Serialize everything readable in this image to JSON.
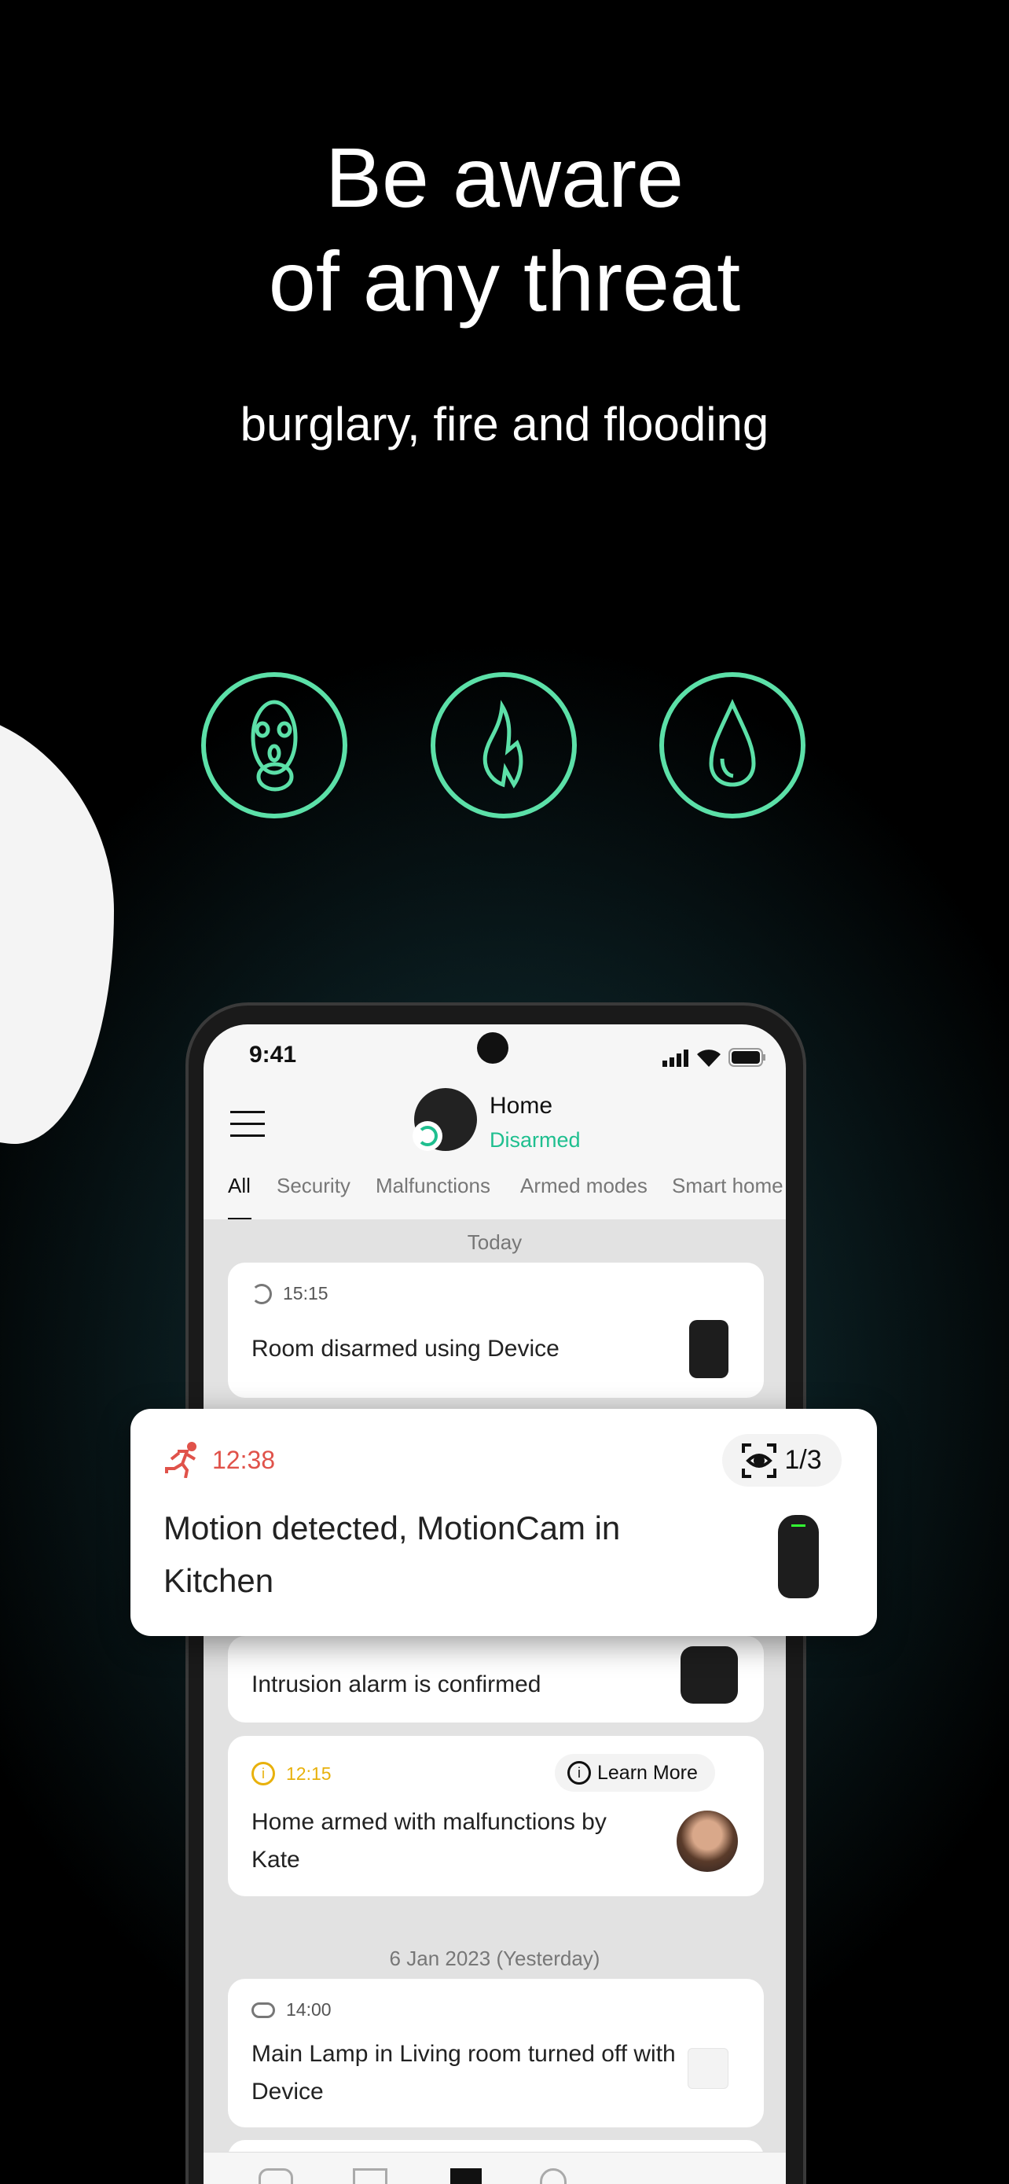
{
  "hero": {
    "title_line1": "Be aware",
    "title_line2": "of any threat",
    "subtitle": "burglary, fire and flooding"
  },
  "threat_icons": [
    "balaclava-mask-icon",
    "fire-icon",
    "water-drop-icon"
  ],
  "colors": {
    "accent": "#5ce0a8",
    "disarmed": "#1fbf8f",
    "alarm": "#e0524a",
    "warning": "#e8b10c"
  },
  "status_bar": {
    "time": "9:41"
  },
  "header": {
    "hub_name": "Home",
    "status": "Disarmed"
  },
  "tabs": [
    {
      "label": "All",
      "active": true
    },
    {
      "label": "Security"
    },
    {
      "label": "Malfunctions"
    },
    {
      "label": "Armed modes"
    },
    {
      "label": "Smart home"
    }
  ],
  "sections": {
    "today": "Today",
    "yesterday": "6 Jan 2023 (Yesterday)"
  },
  "events": [
    {
      "time": "15:15",
      "text": "Room disarmed using Device",
      "icon": "disarm-icon"
    },
    {
      "time": "12:38",
      "text": "Motion detected, MotionCam in Kitchen",
      "icon": "running-person-icon",
      "photos": "1/3"
    },
    {
      "text": "Intrusion alarm is confirmed"
    },
    {
      "time": "12:15",
      "text": "Home armed with malfunctions by Kate",
      "icon": "info-icon",
      "action": "Learn More"
    },
    {
      "time": "14:00",
      "text": "Main Lamp in Living room turned off with Device",
      "icon": "toggle-icon"
    }
  ]
}
